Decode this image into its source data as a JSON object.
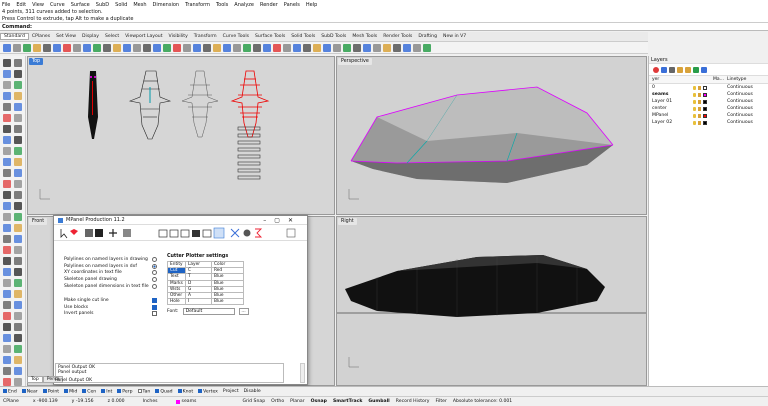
{
  "menu": [
    "File",
    "Edit",
    "View",
    "Curve",
    "Surface",
    "SubD",
    "Solid",
    "Mesh",
    "Dimension",
    "Transform",
    "Tools",
    "Analyze",
    "Render",
    "Panels",
    "Help"
  ],
  "command_history": [
    "4 points, 311 curves added to selection.",
    "Press Control to extrude, tap Alt to make a duplicate"
  ],
  "command_prompt": "Command:",
  "tabs": [
    "Standard",
    "CPlanes",
    "Set View",
    "Display",
    "Select",
    "Viewport Layout",
    "Visibility",
    "Transform",
    "Curve Tools",
    "Surface Tools",
    "Solid Tools",
    "SubD Tools",
    "Mesh Tools",
    "Render Tools",
    "Drafting",
    "New in V7"
  ],
  "viewports": {
    "top": "Top",
    "perspective": "Perspective",
    "front": "Front",
    "right": "Right"
  },
  "layers": {
    "panel_title": "Layers",
    "columns": {
      "name": "yer",
      "material": "Ma...",
      "linetype": "Linetype"
    },
    "rows": [
      {
        "name": "0",
        "color": "#ffffff",
        "linetype": "Continuous",
        "bold": false
      },
      {
        "name": "seams",
        "color": "#ff00ff",
        "linetype": "Continuous",
        "bold": true
      },
      {
        "name": "Layer 01",
        "color": "#000000",
        "linetype": "Continuous",
        "bold": false
      },
      {
        "name": "center",
        "color": "#000000",
        "linetype": "Continuous",
        "bold": false
      },
      {
        "name": "MPanel",
        "color": "#ff0000",
        "linetype": "Continuous",
        "bold": false
      },
      {
        "name": "Layer 02",
        "color": "#000000",
        "linetype": "Continuous",
        "bold": false
      }
    ]
  },
  "dialog": {
    "title": "MPanel Production 11.2",
    "options": [
      {
        "label": "Polylines on named layers in drawing",
        "type": "radio",
        "checked": false
      },
      {
        "label": "Polylines on named layers in dxf",
        "type": "radio",
        "checked": true
      },
      {
        "label": "XY coordinates in text file",
        "type": "radio",
        "checked": false
      },
      {
        "label": "Skeleton panel drawing",
        "type": "radio",
        "checked": false
      },
      {
        "label": "Skeleton panel dimensions in text file",
        "type": "radio",
        "checked": false
      }
    ],
    "checks": [
      {
        "label": "Make single cut line",
        "checked": true
      },
      {
        "label": "Use blocks",
        "checked": true
      },
      {
        "label": "Invert panels",
        "checked": false
      }
    ],
    "plotter": {
      "title": "Cutter Plotter settings",
      "headers": [
        "Entity",
        "Layer",
        "Color"
      ],
      "rows": [
        [
          "Cut",
          "C",
          "Red"
        ],
        [
          "Text",
          "T",
          "Blue"
        ],
        [
          "Marks",
          "D",
          "Blue"
        ],
        [
          "Wsts",
          "G",
          "Blue"
        ],
        [
          "Other",
          "A",
          "Blue"
        ],
        [
          "Hole",
          "I",
          "Blue"
        ]
      ],
      "font_label": "Font:",
      "font_value": "Default",
      "browse": "..."
    },
    "log": [
      "Panel Output OK",
      "Panel output"
    ]
  },
  "bottom_tabs": [
    "Top",
    "Persp"
  ],
  "overlay_log": "Panel Output OK",
  "osnaps": [
    "End",
    "Near",
    "Point",
    "Mid",
    "Cen",
    "Int",
    "Perp",
    "Tan",
    "Quad",
    "Knot",
    "Vertex",
    "Project",
    "Disable"
  ],
  "osnap_on": [
    true,
    true,
    true,
    true,
    true,
    true,
    true,
    false,
    true,
    true,
    true,
    false,
    false
  ],
  "status": {
    "cplane": "CPlane",
    "x": "x -900.139",
    "y": "y -19.156",
    "z": "z 0.000",
    "units": "Inches",
    "layer": "seams",
    "grid": "Grid Snap",
    "ortho": "Ortho",
    "planar": "Planar",
    "osnap": "Osnap",
    "smarttrack": "SmartTrack",
    "gumball": "Gumball",
    "history": "Record History",
    "filter": "Filter",
    "tolerance": "Absolute tolerance: 0.001"
  }
}
